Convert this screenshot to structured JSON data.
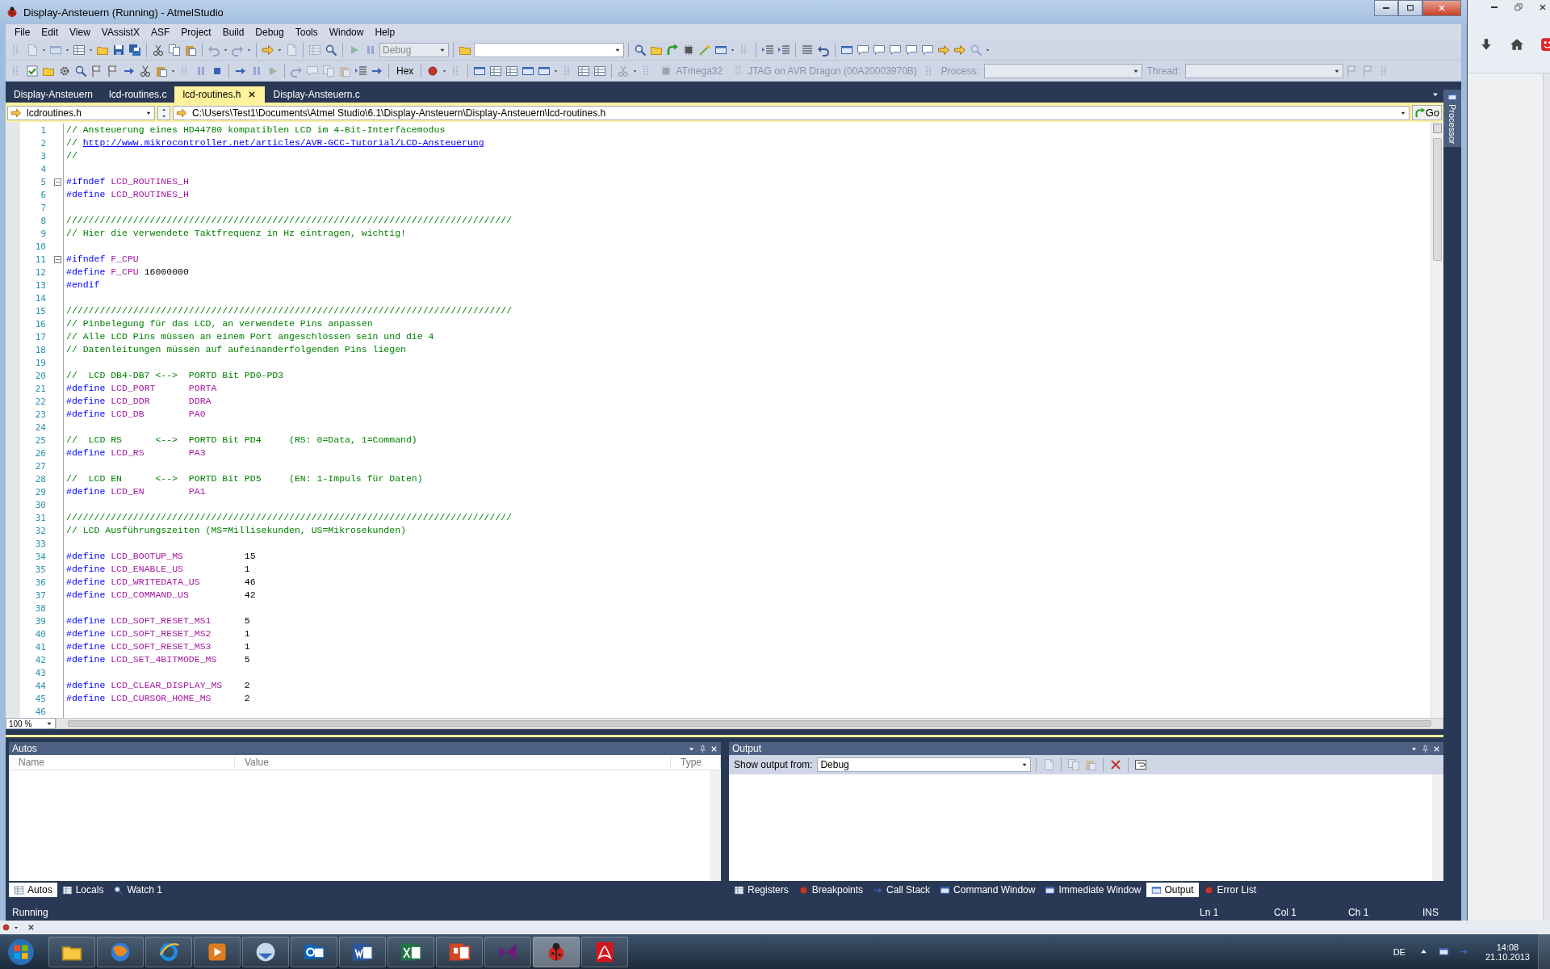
{
  "window": {
    "title": "Display-Ansteuern (Running) - AtmelStudio"
  },
  "menu": [
    "File",
    "Edit",
    "View",
    "VAssistX",
    "ASF",
    "Project",
    "Build",
    "Debug",
    "Tools",
    "Window",
    "Help"
  ],
  "toolbar_standard": {
    "config_combo": {
      "value": "Debug",
      "disabled": true
    }
  },
  "toolbar_debug": {
    "hex_button": "Hex",
    "device": {
      "label": "ATmega32",
      "disabled": true
    },
    "tool": {
      "label": "JTAG on AVR Dragon (00A20003970B)",
      "disabled": true
    },
    "process": {
      "label": "Process:",
      "disabled": true
    },
    "thread": {
      "label": "Thread:",
      "disabled": true
    }
  },
  "document_tabs": [
    {
      "label": "Display-Ansteuern",
      "selected": false
    },
    {
      "label": "lcd-routines.c",
      "selected": false
    },
    {
      "label": "lcd-routines.h",
      "selected": true
    },
    {
      "label": "Display-Ansteuern.c",
      "selected": false
    }
  ],
  "navigation_bar": {
    "scope": "lcdroutines.h",
    "path": "C:\\Users\\Test1\\Documents\\Atmel Studio\\6.1\\Display-Ansteuern\\Display-Ansteuern\\lcd-routines.h",
    "go_button": "Go"
  },
  "side_tab": "Processor",
  "editor": {
    "zoom": "100 %",
    "lines": [
      {
        "n": "1",
        "fold": false,
        "tokens": [
          {
            "kind": "comment",
            "text": "// Ansteuerung eines HD44780 kompatiblen LCD im 4-Bit-Interfacemodus"
          }
        ]
      },
      {
        "n": "2",
        "fold": false,
        "tokens": [
          {
            "kind": "comment",
            "text": "// "
          },
          {
            "kind": "link",
            "text": "http://www.mikrocontroller.net/articles/AVR-GCC-Tutorial/LCD-Ansteuerung"
          }
        ]
      },
      {
        "n": "3",
        "fold": false,
        "tokens": [
          {
            "kind": "comment",
            "text": "//"
          }
        ]
      },
      {
        "n": "4",
        "fold": false
      },
      {
        "n": "5",
        "fold": true,
        "tokens": [
          {
            "kind": "keyword",
            "text": "#ifndef "
          },
          {
            "kind": "macro",
            "text": "LCD_ROUTINES_H"
          }
        ]
      },
      {
        "n": "6",
        "fold": false,
        "tokens": [
          {
            "kind": "keyword",
            "text": "#define "
          },
          {
            "kind": "macro",
            "text": "LCD_ROUTINES_H"
          }
        ]
      },
      {
        "n": "7",
        "fold": false
      },
      {
        "n": "8",
        "fold": false,
        "tokens": [
          {
            "kind": "comment",
            "text": "////////////////////////////////////////////////////////////////////////////////"
          }
        ]
      },
      {
        "n": "9",
        "fold": false,
        "tokens": [
          {
            "kind": "comment",
            "text": "// Hier die verwendete Taktfrequenz in Hz eintragen, wichtig!"
          }
        ]
      },
      {
        "n": "10",
        "fold": false
      },
      {
        "n": "11",
        "fold": true,
        "tokens": [
          {
            "kind": "keyword",
            "text": "#ifndef "
          },
          {
            "kind": "macro",
            "text": "F_CPU"
          }
        ]
      },
      {
        "n": "12",
        "fold": false,
        "tokens": [
          {
            "kind": "keyword",
            "text": "#define "
          },
          {
            "kind": "macro",
            "text": "F_CPU "
          },
          {
            "kind": "number",
            "text": "16000000"
          }
        ]
      },
      {
        "n": "13",
        "fold": false,
        "tokens": [
          {
            "kind": "keyword",
            "text": "#endif"
          }
        ]
      },
      {
        "n": "14",
        "fold": false
      },
      {
        "n": "15",
        "fold": false,
        "tokens": [
          {
            "kind": "comment",
            "text": "////////////////////////////////////////////////////////////////////////////////"
          }
        ]
      },
      {
        "n": "16",
        "fold": false,
        "tokens": [
          {
            "kind": "comment",
            "text": "// Pinbelegung für das LCD, an verwendete Pins anpassen"
          }
        ]
      },
      {
        "n": "17",
        "fold": false,
        "tokens": [
          {
            "kind": "comment",
            "text": "// Alle LCD Pins müssen an einem Port angeschlossen sein und die 4"
          }
        ]
      },
      {
        "n": "18",
        "fold": false,
        "tokens": [
          {
            "kind": "comment",
            "text": "// Datenleitungen müssen auf aufeinanderfolgenden Pins liegen"
          }
        ]
      },
      {
        "n": "19",
        "fold": false
      },
      {
        "n": "20",
        "fold": false,
        "tokens": [
          {
            "kind": "comment",
            "text": "//  LCD DB4-DB7 <-->  PORTD Bit PD0-PD3"
          }
        ]
      },
      {
        "n": "21",
        "fold": false,
        "tokens": [
          {
            "kind": "keyword",
            "text": "#define "
          },
          {
            "kind": "macro",
            "text": "LCD_PORT      PORTA"
          }
        ]
      },
      {
        "n": "22",
        "fold": false,
        "tokens": [
          {
            "kind": "keyword",
            "text": "#define "
          },
          {
            "kind": "macro",
            "text": "LCD_DDR       DDRA"
          }
        ]
      },
      {
        "n": "23",
        "fold": false,
        "tokens": [
          {
            "kind": "keyword",
            "text": "#define "
          },
          {
            "kind": "macro",
            "text": "LCD_DB        PA0"
          }
        ]
      },
      {
        "n": "24",
        "fold": false
      },
      {
        "n": "25",
        "fold": false,
        "tokens": [
          {
            "kind": "comment",
            "text": "//  LCD RS      <-->  PORTD Bit PD4     (RS: 0=Data, 1=Command)"
          }
        ]
      },
      {
        "n": "26",
        "fold": false,
        "tokens": [
          {
            "kind": "keyword",
            "text": "#define "
          },
          {
            "kind": "macro",
            "text": "LCD_RS        PA3"
          }
        ]
      },
      {
        "n": "27",
        "fold": false
      },
      {
        "n": "28",
        "fold": false,
        "tokens": [
          {
            "kind": "comment",
            "text": "//  LCD EN      <-->  PORTD Bit PD5     (EN: 1-Impuls für Daten)"
          }
        ]
      },
      {
        "n": "29",
        "fold": false,
        "tokens": [
          {
            "kind": "keyword",
            "text": "#define "
          },
          {
            "kind": "macro",
            "text": "LCD_EN        PA1"
          }
        ]
      },
      {
        "n": "30",
        "fold": false
      },
      {
        "n": "31",
        "fold": false,
        "tokens": [
          {
            "kind": "comment",
            "text": "////////////////////////////////////////////////////////////////////////////////"
          }
        ]
      },
      {
        "n": "32",
        "fold": false,
        "tokens": [
          {
            "kind": "comment",
            "text": "// LCD Ausführungszeiten (MS=Millisekunden, US=Mikrosekunden)"
          }
        ]
      },
      {
        "n": "33",
        "fold": false
      },
      {
        "n": "34",
        "fold": false,
        "tokens": [
          {
            "kind": "keyword",
            "text": "#define "
          },
          {
            "kind": "macro",
            "text": "LCD_BOOTUP_MS           "
          },
          {
            "kind": "number",
            "text": "15"
          }
        ]
      },
      {
        "n": "35",
        "fold": false,
        "tokens": [
          {
            "kind": "keyword",
            "text": "#define "
          },
          {
            "kind": "macro",
            "text": "LCD_ENABLE_US           "
          },
          {
            "kind": "number",
            "text": "1"
          }
        ]
      },
      {
        "n": "36",
        "fold": false,
        "tokens": [
          {
            "kind": "keyword",
            "text": "#define "
          },
          {
            "kind": "macro",
            "text": "LCD_WRITEDATA_US        "
          },
          {
            "kind": "number",
            "text": "46"
          }
        ]
      },
      {
        "n": "37",
        "fold": false,
        "tokens": [
          {
            "kind": "keyword",
            "text": "#define "
          },
          {
            "kind": "macro",
            "text": "LCD_COMMAND_US          "
          },
          {
            "kind": "number",
            "text": "42"
          }
        ]
      },
      {
        "n": "38",
        "fold": false
      },
      {
        "n": "39",
        "fold": false,
        "tokens": [
          {
            "kind": "keyword",
            "text": "#define "
          },
          {
            "kind": "macro",
            "text": "LCD_SOFT_RESET_MS1      "
          },
          {
            "kind": "number",
            "text": "5"
          }
        ]
      },
      {
        "n": "40",
        "fold": false,
        "tokens": [
          {
            "kind": "keyword",
            "text": "#define "
          },
          {
            "kind": "macro",
            "text": "LCD_SOFT_RESET_MS2      "
          },
          {
            "kind": "number",
            "text": "1"
          }
        ]
      },
      {
        "n": "41",
        "fold": false,
        "tokens": [
          {
            "kind": "keyword",
            "text": "#define "
          },
          {
            "kind": "macro",
            "text": "LCD_SOFT_RESET_MS3      "
          },
          {
            "kind": "number",
            "text": "1"
          }
        ]
      },
      {
        "n": "42",
        "fold": false,
        "tokens": [
          {
            "kind": "keyword",
            "text": "#define "
          },
          {
            "kind": "macro",
            "text": "LCD_SET_4BITMODE_MS     "
          },
          {
            "kind": "number",
            "text": "5"
          }
        ]
      },
      {
        "n": "43",
        "fold": false
      },
      {
        "n": "44",
        "fold": false,
        "tokens": [
          {
            "kind": "keyword",
            "text": "#define "
          },
          {
            "kind": "macro",
            "text": "LCD_CLEAR_DISPLAY_MS    "
          },
          {
            "kind": "number",
            "text": "2"
          }
        ]
      },
      {
        "n": "45",
        "fold": false,
        "tokens": [
          {
            "kind": "keyword",
            "text": "#define "
          },
          {
            "kind": "macro",
            "text": "LCD_CURSOR_HOME_MS      "
          },
          {
            "kind": "number",
            "text": "2"
          }
        ]
      },
      {
        "n": "46",
        "fold": false
      }
    ]
  },
  "autos_panel": {
    "title": "Autos",
    "columns": [
      "Name",
      "Value",
      "Type"
    ]
  },
  "output_panel": {
    "title": "Output",
    "show_from_label": "Show output from:",
    "source": "Debug"
  },
  "bottom_left_tabs": [
    {
      "label": "Autos",
      "selected": true
    },
    {
      "label": "Locals",
      "selected": false
    },
    {
      "label": "Watch 1",
      "selected": false
    }
  ],
  "bottom_right_tabs": [
    {
      "label": "Registers",
      "selected": false
    },
    {
      "label": "Breakpoints",
      "selected": false
    },
    {
      "label": "Call Stack",
      "selected": false
    },
    {
      "label": "Command Window",
      "selected": false
    },
    {
      "label": "Immediate Window",
      "selected": false
    },
    {
      "label": "Output",
      "selected": true
    },
    {
      "label": "Error List",
      "selected": false
    }
  ],
  "status_bar": {
    "state": "Running",
    "line": "Ln 1",
    "column": "Col 1",
    "char": "Ch 1",
    "mode": "INS"
  },
  "taskbar": {
    "apps": [
      {
        "selected": false
      },
      {
        "selected": false
      },
      {
        "selected": false
      },
      {
        "selected": false
      },
      {
        "selected": false
      },
      {
        "selected": false
      },
      {
        "selected": false
      },
      {
        "selected": false
      },
      {
        "selected": false
      },
      {
        "selected": false
      },
      {
        "selected": true
      },
      {
        "selected": false
      }
    ],
    "language": "DE",
    "time": "14:08",
    "date": "21.10.2013"
  }
}
